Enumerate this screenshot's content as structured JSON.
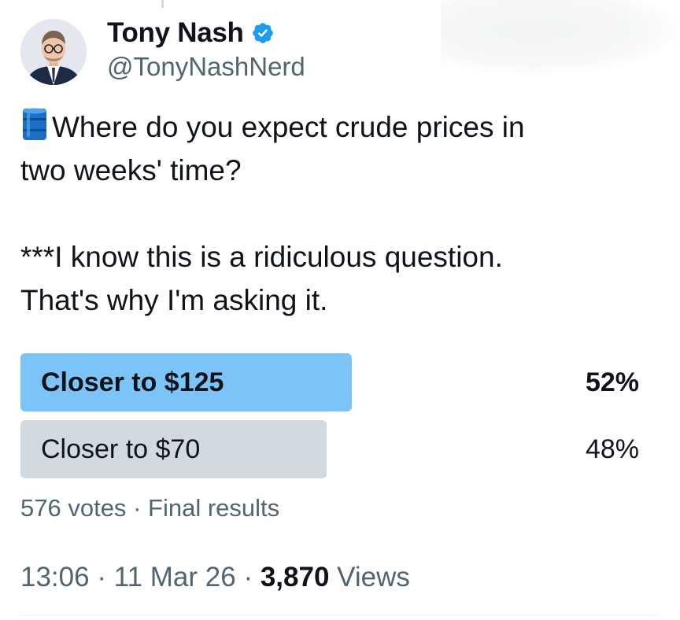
{
  "author": {
    "display_name": "Tony Nash",
    "handle": "@TonyNashNerd",
    "verified_icon": "verified-badge-icon",
    "accent_color": "#1d9bf0"
  },
  "tweet": {
    "emoji_icon": "oil-drum-icon",
    "line1": "Where do you expect crude prices in",
    "line2": "two weeks' time?",
    "line3": "***I know this is a ridiculous question.",
    "line4": "That's why I'm asking it."
  },
  "poll": {
    "options": [
      {
        "label": "Closer to $125",
        "percent": "52%",
        "fraction": 0.52,
        "winner": true,
        "fill_color": "#7cc3f7"
      },
      {
        "label": "Closer to $70",
        "percent": "48%",
        "fraction": 0.48,
        "winner": false,
        "fill_color": "#d2dadf"
      }
    ],
    "votes": "576 votes",
    "separator": "·",
    "status": "Final results"
  },
  "meta": {
    "time": "13:06",
    "date": "11 Mar 26",
    "separator": "·",
    "views_count": "3,870",
    "views_label": "Views"
  }
}
